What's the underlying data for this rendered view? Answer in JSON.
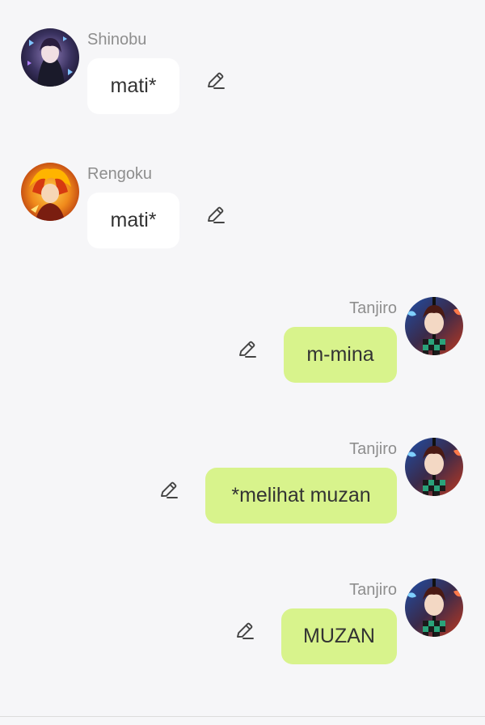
{
  "theme": {
    "background": "#f6f6f8",
    "incoming_bubble": "#ffffff",
    "outgoing_bubble": "#d8f38c",
    "name_color": "#8e8e8e",
    "text_color": "#333333"
  },
  "messages": [
    {
      "sender": "Shinobu",
      "text": "mati*",
      "direction": "incoming",
      "avatar": "shinobu-avatar",
      "action_icon": "pencil-edit-icon"
    },
    {
      "sender": "Rengoku",
      "text": "mati*",
      "direction": "incoming",
      "avatar": "rengoku-avatar",
      "action_icon": "pencil-edit-icon"
    },
    {
      "sender": "Tanjiro",
      "text": "m-mina",
      "direction": "outgoing",
      "avatar": "tanjiro-avatar",
      "action_icon": "pencil-edit-icon"
    },
    {
      "sender": "Tanjiro",
      "text": "*melihat muzan",
      "direction": "outgoing",
      "avatar": "tanjiro-avatar",
      "action_icon": "pencil-edit-icon"
    },
    {
      "sender": "Tanjiro",
      "text": "MUZAN",
      "direction": "outgoing",
      "avatar": "tanjiro-avatar",
      "action_icon": "pencil-edit-icon"
    }
  ]
}
